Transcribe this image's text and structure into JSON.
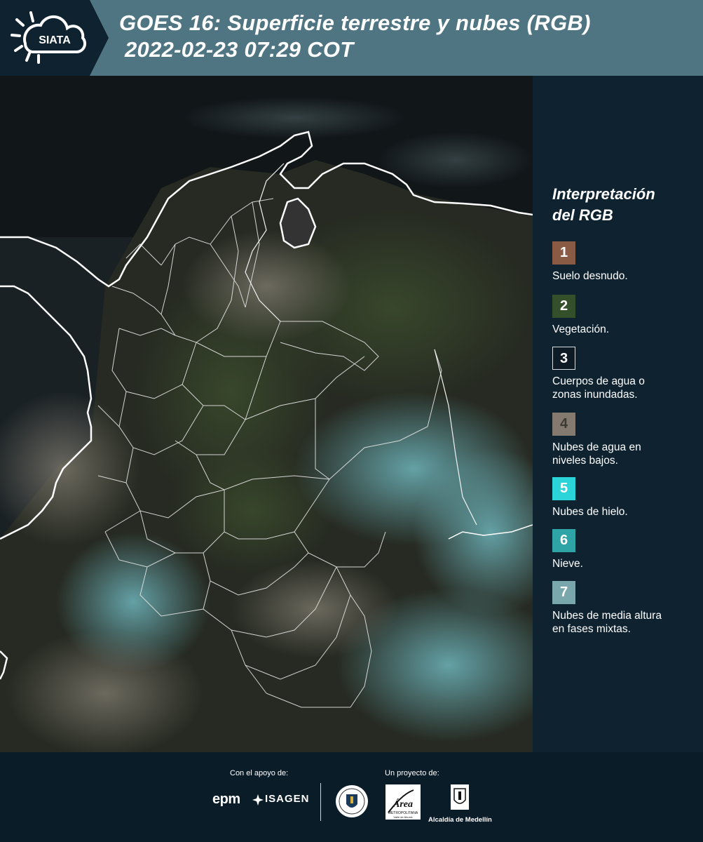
{
  "header": {
    "logo_text": "SIATA",
    "title_line1": "GOES 16: Superficie terrestre y nubes (RGB)",
    "title_line2": "2022-02-23 07:29 COT",
    "background_color": "#4f7482"
  },
  "legend": {
    "title_line1": "Interpretación",
    "title_line2": "del RGB",
    "items": [
      {
        "number": "1",
        "label": "Suelo desnudo.",
        "color": "#8a5b44"
      },
      {
        "number": "2",
        "label": "Vegetación.",
        "color": "#33502a"
      },
      {
        "number": "3",
        "label_line1": "Cuerpos de agua o",
        "label_line2": "zonas inundadas.",
        "color": "#0e1a24"
      },
      {
        "number": "4",
        "label_line1": "Nubes de agua en",
        "label_line2": "niveles bajos.",
        "color": "#847a6f"
      },
      {
        "number": "5",
        "label": "Nubes de hielo.",
        "color": "#2ad4d8"
      },
      {
        "number": "6",
        "label": "Nieve.",
        "color": "#2ea4a6"
      },
      {
        "number": "7",
        "label_line1": "Nubes de media altura",
        "label_line2": "en fases mixtas.",
        "color": "#7aa7ab"
      }
    ]
  },
  "footer": {
    "support_label": "Con el apoyo de:",
    "project_label": "Un proyecto de:",
    "epm_text": "epm",
    "isagen_text": "ISAGEN",
    "area_text": "Área",
    "area_subtext": "METROPOLITANA",
    "area_subtext2": "Valle de Aburrá",
    "alcaldia_text": "Alcaldía de Medellín"
  }
}
